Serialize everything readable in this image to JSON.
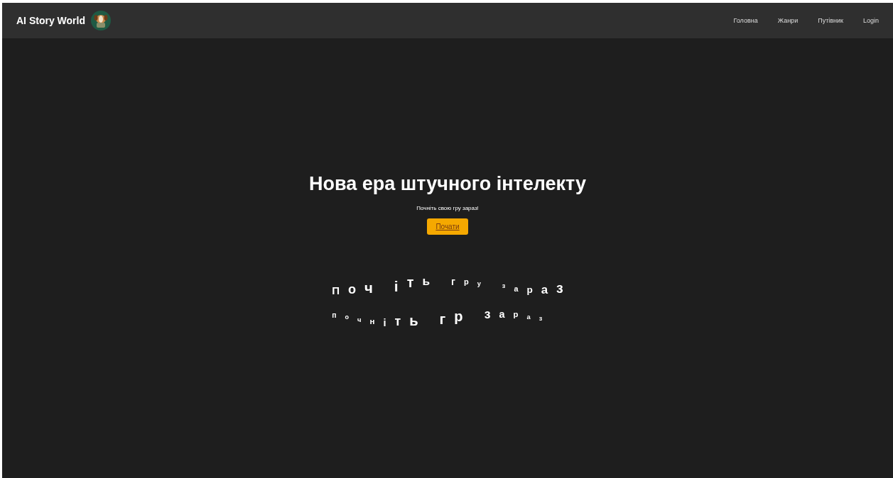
{
  "navbar": {
    "brand": "AI Story World",
    "links": [
      "Головна",
      "Жанри",
      "Путівник",
      "Login"
    ]
  },
  "hero": {
    "title": "Нова ера штучного інтелекту",
    "subtitle": "Почніть свою гру зараз!",
    "button": "Почати"
  },
  "wave_text": [
    {
      "words": [
        [
          "П",
          "о",
          "ч"
        ],
        [
          "і",
          "т",
          "ь"
        ],
        [
          "г",
          "р",
          "у"
        ],
        [
          "з",
          "а",
          "р",
          "а",
          "з"
        ]
      ]
    },
    {
      "words": [
        [
          "п",
          "о",
          "ч",
          "н",
          "і",
          "т",
          "ь"
        ],
        [
          "г",
          "р"
        ],
        [
          "з",
          "а",
          "р",
          "а",
          "з"
        ]
      ]
    }
  ]
}
